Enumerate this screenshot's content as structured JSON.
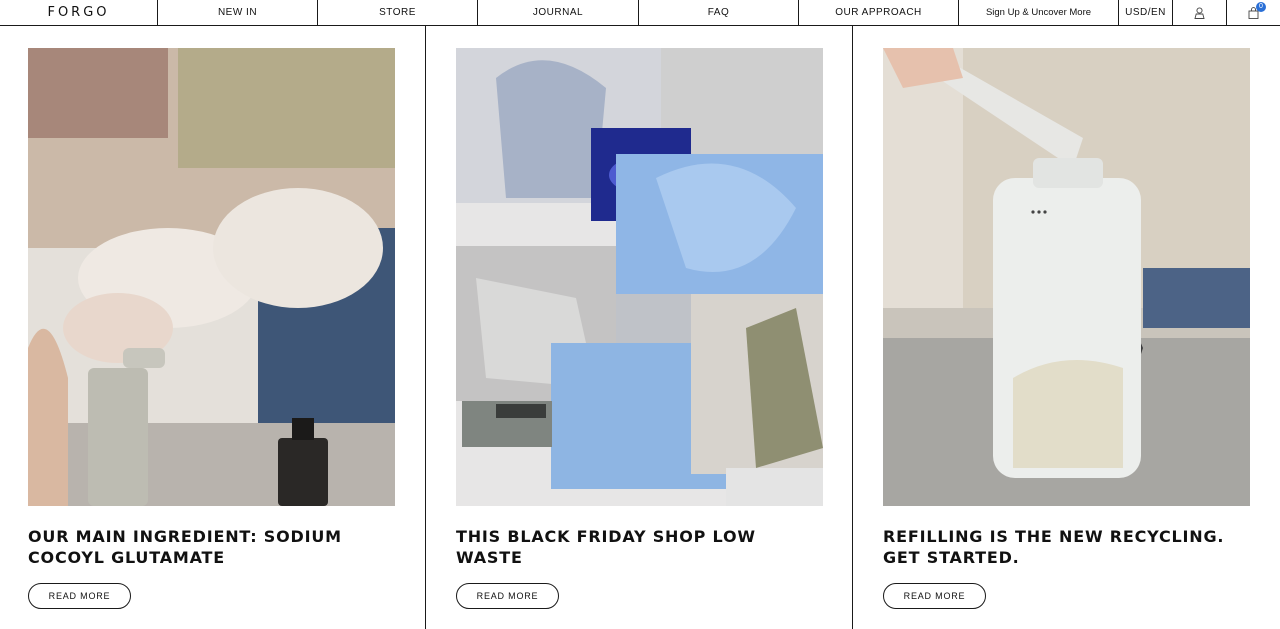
{
  "nav": {
    "logo": "FORGO",
    "new_in": "NEW IN",
    "store": "STORE",
    "journal": "JOURNAL",
    "faq": "FAQ",
    "our_approach": "OUR APPROACH",
    "signup": "Sign Up & Uncover More",
    "currency": "USD/EN",
    "account_icon": "person-icon",
    "bag_icon": "bag-icon",
    "bag_count": "0"
  },
  "articles": [
    {
      "title": "OUR MAIN INGREDIENT: SODIUM COCOYL GLUTAMATE",
      "cta": "READ MORE"
    },
    {
      "title": "THIS BLACK FRIDAY SHOP LOW WASTE",
      "cta": "READ MORE"
    },
    {
      "title": "REFILLING IS THE NEW RECYCLING. GET STARTED.",
      "cta": "READ MORE"
    }
  ],
  "colors": {
    "accent": "#2a6fd6",
    "border": "#1a1a1a"
  }
}
